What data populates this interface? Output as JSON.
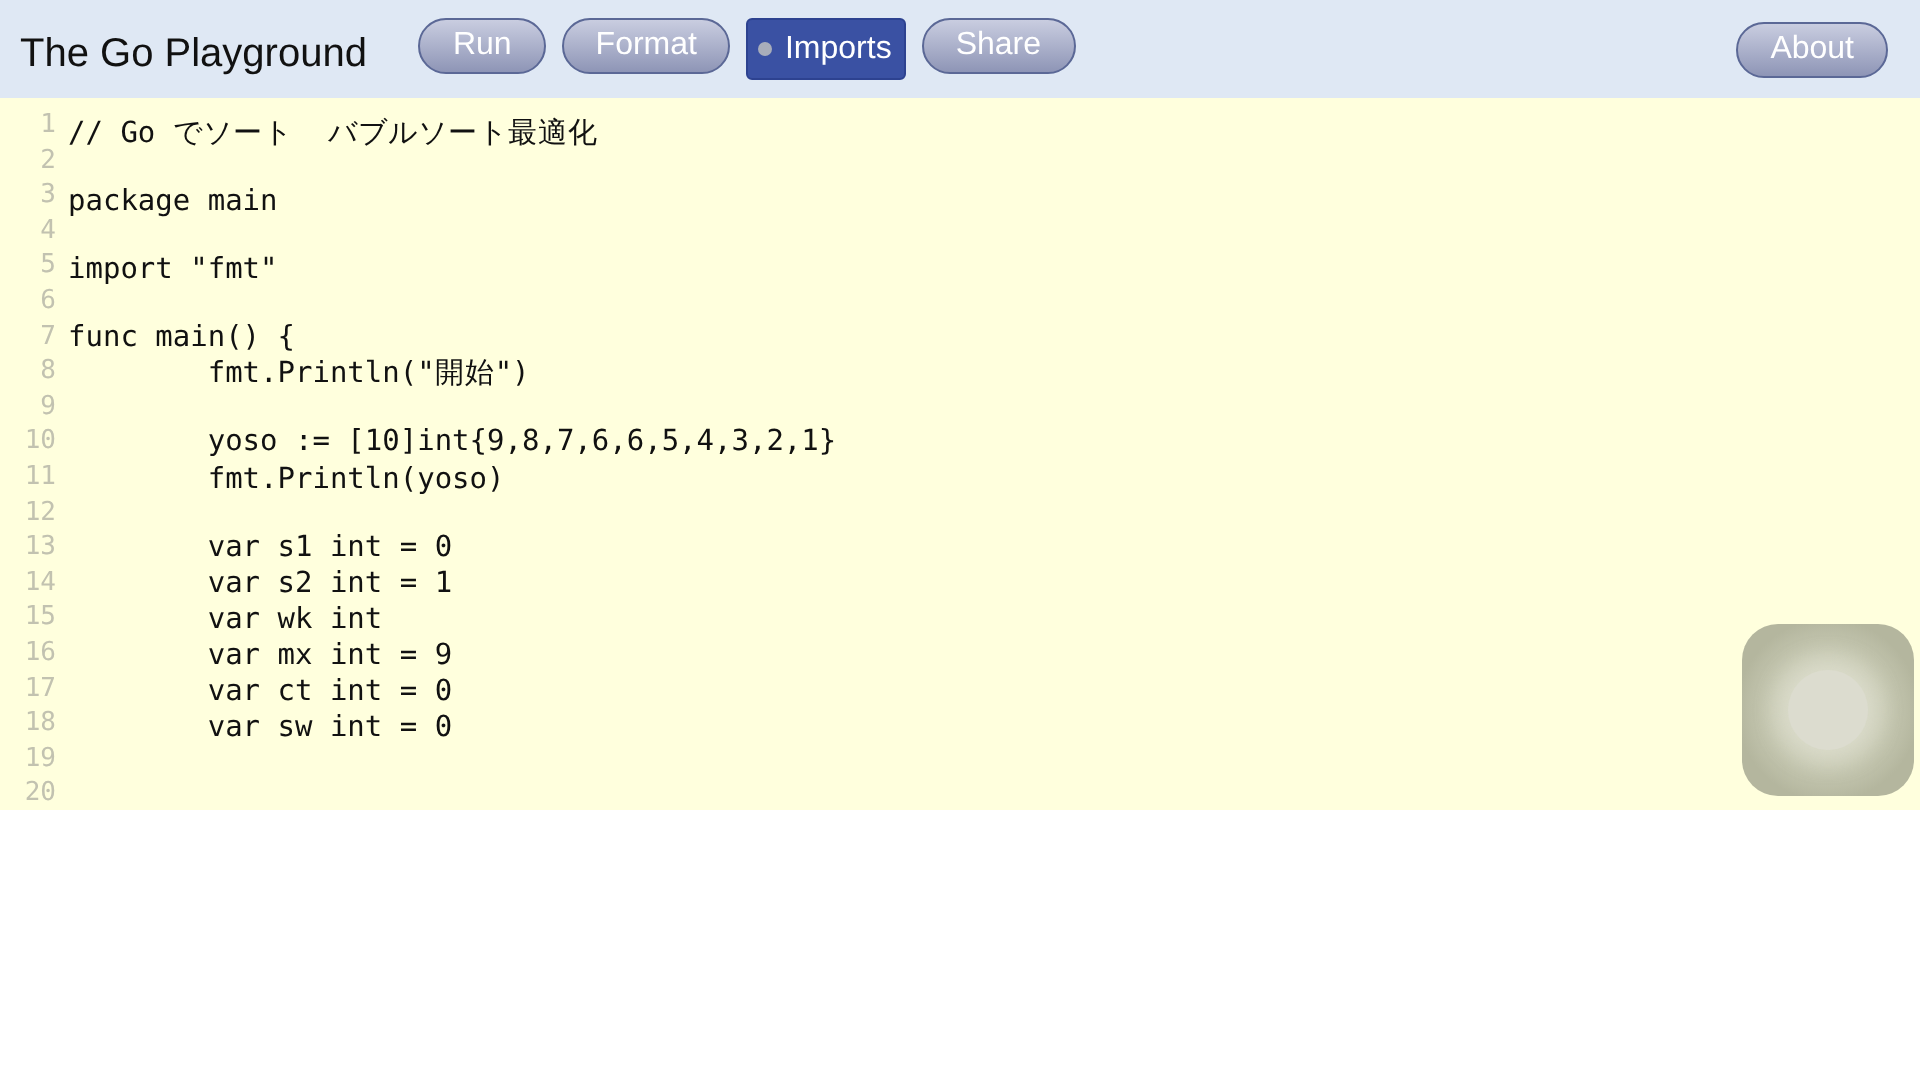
{
  "header": {
    "title": "The Go Playground",
    "buttons": [
      {
        "label": "Run",
        "kind": "pill",
        "selected": false
      },
      {
        "label": "Format",
        "kind": "pill",
        "selected": false
      },
      {
        "label": "Imports",
        "kind": "toggle",
        "selected": true
      },
      {
        "label": "Share",
        "kind": "pill",
        "selected": false
      }
    ],
    "about_button": {
      "label": "About"
    }
  },
  "editor": {
    "lines": [
      {
        "number": "1",
        "code": "// Go でソート  バブルソート最適化"
      },
      {
        "number": "2"
      },
      {
        "number": "3",
        "code": "package main"
      },
      {
        "number": "4"
      },
      {
        "number": "5",
        "code": "import \"fmt\""
      },
      {
        "number": "6"
      },
      {
        "number": "7",
        "code": "func main() {"
      },
      {
        "number": "8",
        "code": "\tfmt.Println(\"開始\")"
      },
      {
        "number": "9"
      },
      {
        "number": "10",
        "code": "\tyoso := [10]int{9,8,7,6,6,5,4,3,2,1}"
      },
      {
        "number": "11",
        "code": "\tfmt.Println(yoso)"
      },
      {
        "number": "12"
      },
      {
        "number": "13",
        "code": "\tvar s1 int = 0"
      },
      {
        "number": "14",
        "code": "\tvar s2 int = 1"
      },
      {
        "number": "15",
        "code": "\tvar wk int"
      },
      {
        "number": "16",
        "code": "\tvar mx int = 9"
      },
      {
        "number": "17",
        "code": "\tvar ct int = 0"
      },
      {
        "number": "18",
        "code": "\tvar sw int = 0"
      },
      {
        "number": "19"
      },
      {
        "number": "20"
      }
    ]
  }
}
